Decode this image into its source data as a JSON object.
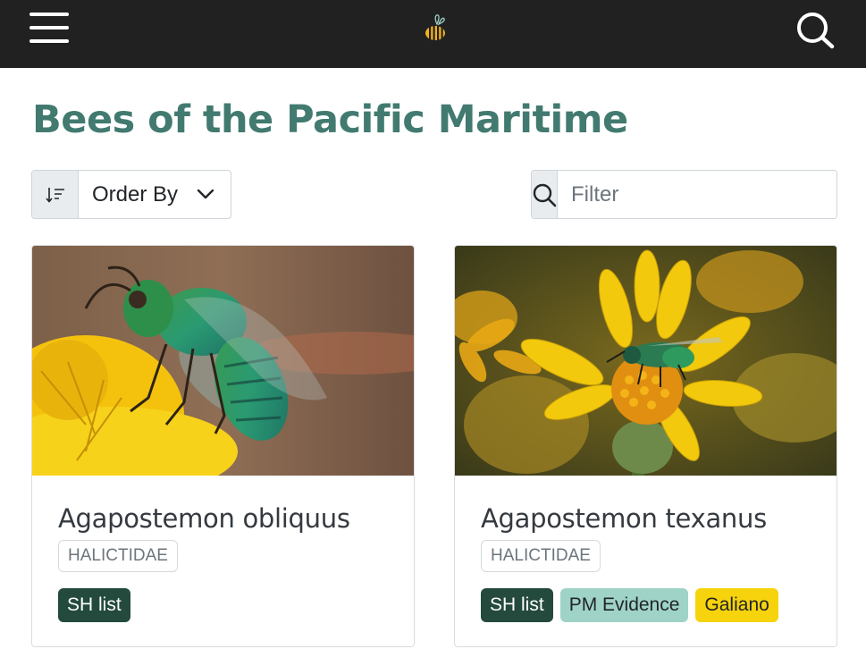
{
  "header": {
    "menu_icon": "hamburger-menu-icon",
    "logo_icon": "bee-logo-icon",
    "search_icon": "search-icon",
    "background": "#212121"
  },
  "page": {
    "title": "Bees of the Pacific Maritime",
    "title_color": "#427a70"
  },
  "controls": {
    "sort_icon": "sort-descending-icon",
    "order_label": "Order By",
    "filter_placeholder": "Filter",
    "filter_value": ""
  },
  "cards": [
    {
      "species": "Agapostemon obliquus",
      "family": "HALICTIDAE",
      "tags": [
        {
          "label": "SH list",
          "color": "#244a3e"
        }
      ]
    },
    {
      "species": "Agapostemon texanus",
      "family": "HALICTIDAE",
      "tags": [
        {
          "label": "SH list",
          "color": "#244a3e"
        },
        {
          "label": "PM Evidence",
          "color": "#9fd3c7"
        },
        {
          "label": "Galiano",
          "color": "#f6d30c"
        }
      ]
    }
  ]
}
